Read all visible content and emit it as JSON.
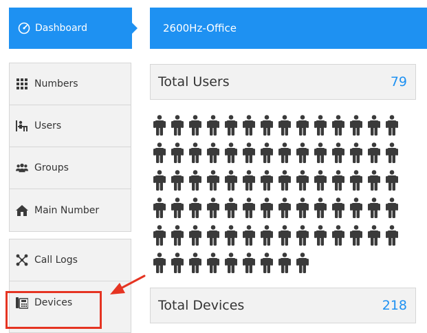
{
  "sidebar": {
    "dashboard": {
      "label": "Dashboard",
      "icon": "dashboard-gauge-icon"
    },
    "items": [
      {
        "key": "numbers",
        "label": "Numbers",
        "icon": "grid-icon"
      },
      {
        "key": "users",
        "label": "Users",
        "icon": "user-desk-icon"
      },
      {
        "key": "groups",
        "label": "Groups",
        "icon": "group-users-icon"
      },
      {
        "key": "main-number",
        "label": "Main Number",
        "icon": "home-icon"
      }
    ],
    "items2": [
      {
        "key": "call-logs",
        "label": "Call Logs",
        "icon": "network-icon"
      },
      {
        "key": "devices",
        "label": "Devices",
        "icon": "desk-phone-icon"
      }
    ]
  },
  "header": {
    "title": "2600Hz-Office"
  },
  "stats": {
    "users": {
      "label": "Total Users",
      "value": "79"
    },
    "devices": {
      "label": "Total Devices",
      "value": "218"
    }
  },
  "people_count": 79,
  "colors": {
    "accent": "#1e91f2",
    "highlight": "#e53422",
    "icon": "#3a3a3a"
  }
}
